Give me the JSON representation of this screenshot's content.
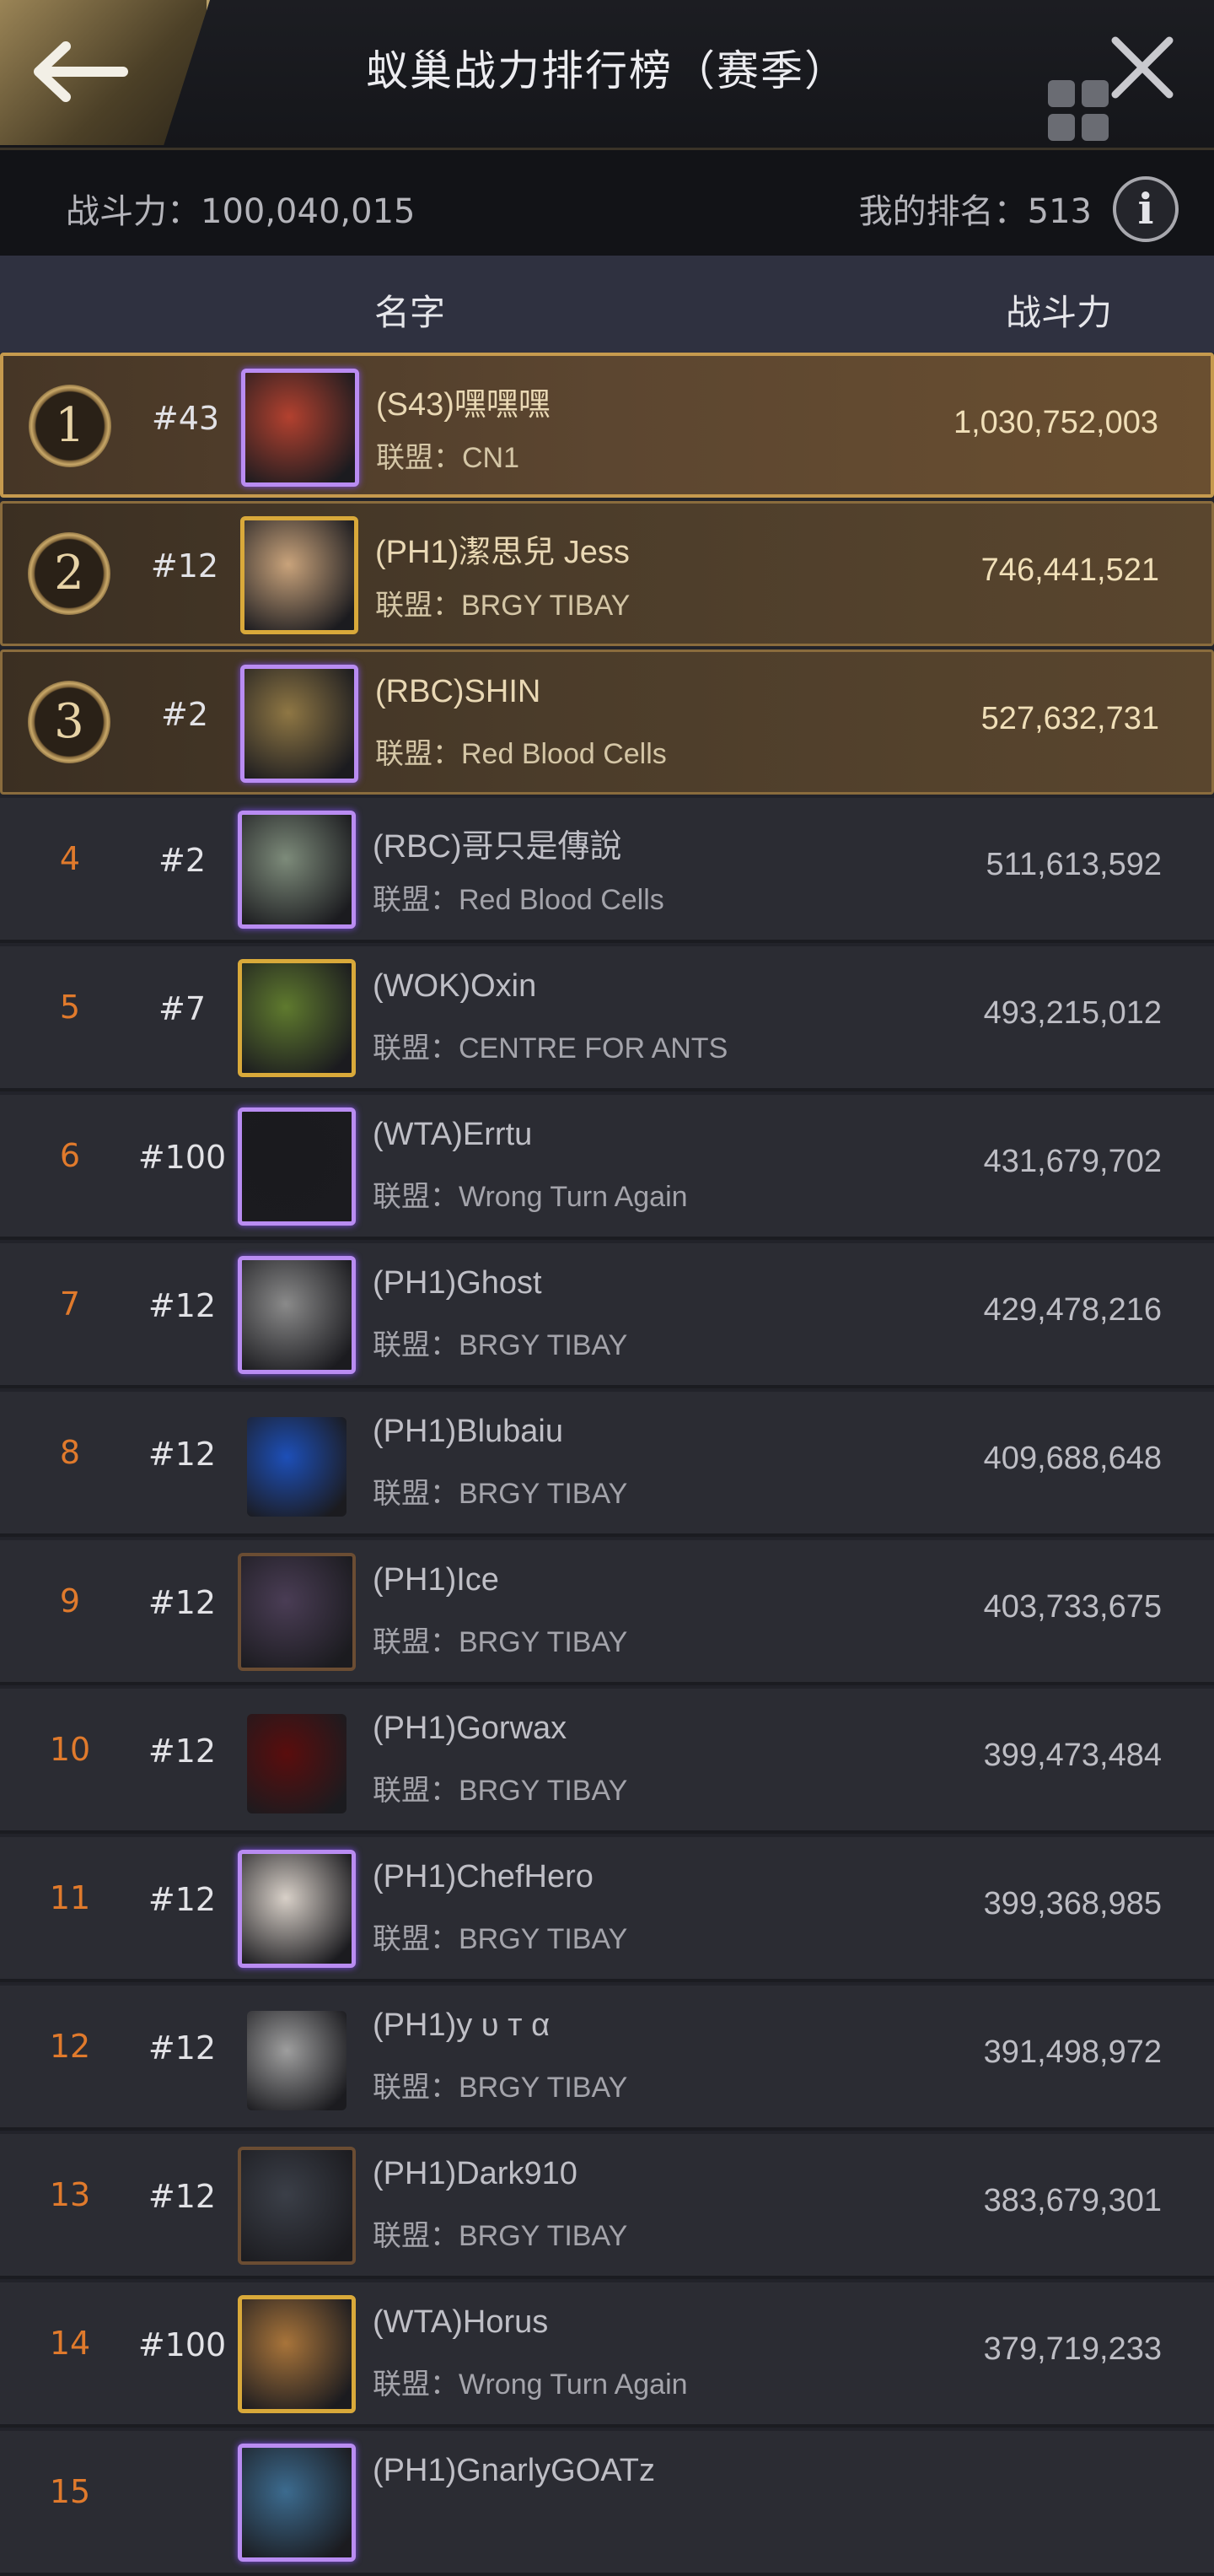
{
  "header": {
    "title": "蚁巢战力排行榜（赛季）"
  },
  "stats": {
    "power_text": "战斗力：100,040,015",
    "rank_text": "我的排名：513"
  },
  "columns": {
    "name": "名字",
    "power": "战斗力"
  },
  "icons": {
    "back": "arrow-left-icon",
    "grid": "grid-menu-icon",
    "close": "close-icon",
    "info": "info-icon"
  },
  "colors": {
    "accent_gold": "#c69a4e",
    "rank_orange": "#e07a2c",
    "background": "#22232a"
  },
  "rows": [
    {
      "rank": "1",
      "server": "#43",
      "name": "(S43)嘿嘿嘿",
      "alliance": "联盟：CN1",
      "power": "1,030,752,003",
      "frame": "purple",
      "av": "#b3412f"
    },
    {
      "rank": "2",
      "server": "#12",
      "name": "(PH1)潔思兒 Jess",
      "alliance": "联盟：BRGY TIBAY",
      "power": "746,441,521",
      "frame": "gold",
      "av": "#c9a37b"
    },
    {
      "rank": "3",
      "server": "#2",
      "name": "(RBC)SHIN",
      "alliance": "联盟：Red Blood Cells",
      "power": "527,632,731",
      "frame": "purple",
      "av": "#8f7744"
    },
    {
      "rank": "4",
      "server": "#2",
      "name": "(RBC)哥只是傳說",
      "alliance": "联盟：Red Blood Cells",
      "power": "511,613,592",
      "frame": "purple",
      "av": "#7d8b7a"
    },
    {
      "rank": "5",
      "server": "#7",
      "name": "(WOK)Oxin",
      "alliance": "联盟：CENTRE FOR ANTS",
      "power": "493,215,012",
      "frame": "gold",
      "av": "#5f7a2e"
    },
    {
      "rank": "6",
      "server": "#100",
      "name": "(WTA)Errtu",
      "alliance": "联盟：Wrong Turn Again",
      "power": "431,679,702",
      "frame": "purple",
      "av": "#1a1a1e"
    },
    {
      "rank": "7",
      "server": "#12",
      "name": "(PH1)Ghost",
      "alliance": "联盟：BRGY TIBAY",
      "power": "429,478,216",
      "frame": "purple",
      "av": "#8a8a8a"
    },
    {
      "rank": "8",
      "server": "#12",
      "name": "(PH1)Blubaiu",
      "alliance": "联盟：BRGY TIBAY",
      "power": "409,688,648",
      "frame": "none",
      "av": "#1d4fb8"
    },
    {
      "rank": "9",
      "server": "#12",
      "name": "(PH1)Ice",
      "alliance": "联盟：BRGY TIBAY",
      "power": "403,733,675",
      "frame": "dark",
      "av": "#4a3d55"
    },
    {
      "rank": "10",
      "server": "#12",
      "name": "(PH1)Gorwax",
      "alliance": "联盟：BRGY TIBAY",
      "power": "399,473,484",
      "frame": "none",
      "av": "#5a0d0d"
    },
    {
      "rank": "11",
      "server": "#12",
      "name": "(PH1)ChefHero",
      "alliance": "联盟：BRGY TIBAY",
      "power": "399,368,985",
      "frame": "purple",
      "av": "#d8d0c8"
    },
    {
      "rank": "12",
      "server": "#12",
      "name": "(PH1)y υ т α",
      "alliance": "联盟：BRGY TIBAY",
      "power": "391,498,972",
      "frame": "none",
      "av": "#9e9e9e"
    },
    {
      "rank": "13",
      "server": "#12",
      "name": "(PH1)Dark910",
      "alliance": "联盟：BRGY TIBAY",
      "power": "383,679,301",
      "frame": "dark",
      "av": "#3b3f48"
    },
    {
      "rank": "14",
      "server": "#100",
      "name": "(WTA)Horus",
      "alliance": "联盟：Wrong Turn Again",
      "power": "379,719,233",
      "frame": "gold",
      "av": "#a8743a"
    },
    {
      "rank": "15",
      "server": "",
      "name": "(PH1)GnarlyGOATz",
      "alliance": "",
      "power": "",
      "frame": "purple",
      "av": "#3c6b8f"
    }
  ]
}
